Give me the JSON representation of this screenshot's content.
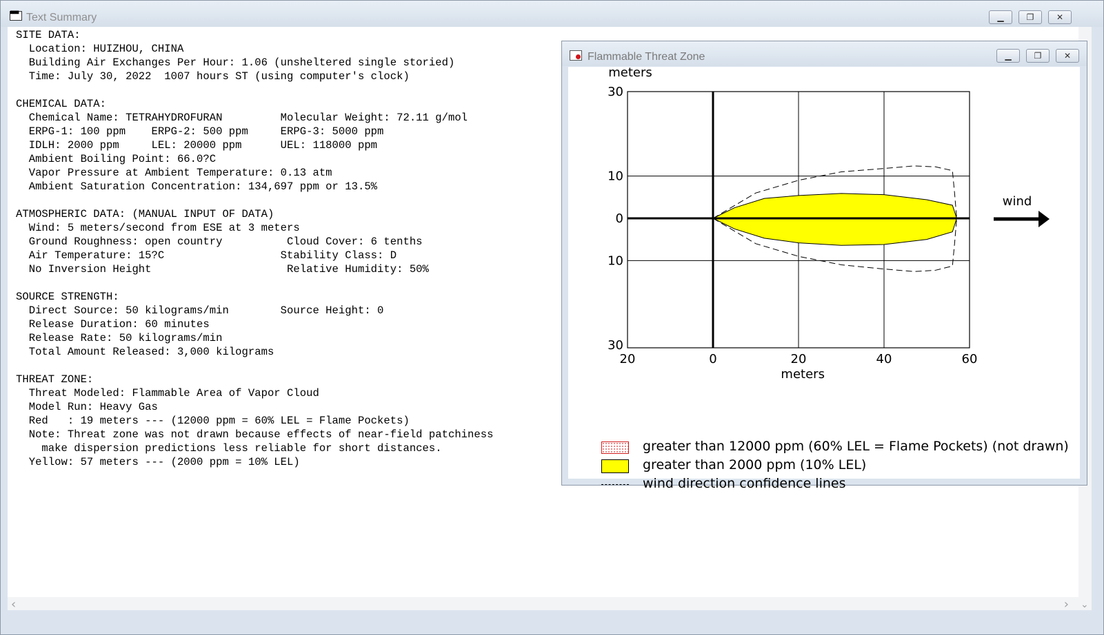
{
  "main_window": {
    "title": "Text Summary",
    "icon": "window-app-icon",
    "controls": {
      "minimize": "minimize-icon",
      "restore": "restore-icon",
      "close": "close-icon"
    }
  },
  "summary_text": "SITE DATA:\n  Location: HUIZHOU, CHINA\n  Building Air Exchanges Per Hour: 1.06 (unsheltered single storied)\n  Time: July 30, 2022  1007 hours ST (using computer's clock)\n\nCHEMICAL DATA:\n  Chemical Name: TETRAHYDROFURAN         Molecular Weight: 72.11 g/mol\n  ERPG-1: 100 ppm    ERPG-2: 500 ppm     ERPG-3: 5000 ppm\n  IDLH: 2000 ppm     LEL: 20000 ppm      UEL: 118000 ppm\n  Ambient Boiling Point: 66.0?C\n  Vapor Pressure at Ambient Temperature: 0.13 atm\n  Ambient Saturation Concentration: 134,697 ppm or 13.5%\n\nATMOSPHERIC DATA: (MANUAL INPUT OF DATA)\n  Wind: 5 meters/second from ESE at 3 meters\n  Ground Roughness: open country          Cloud Cover: 6 tenths\n  Air Temperature: 15?C                  Stability Class: D\n  No Inversion Height                     Relative Humidity: 50%\n\nSOURCE STRENGTH:\n  Direct Source: 50 kilograms/min        Source Height: 0\n  Release Duration: 60 minutes\n  Release Rate: 50 kilograms/min\n  Total Amount Released: 3,000 kilograms\n\nTHREAT ZONE:\n  Threat Modeled: Flammable Area of Vapor Cloud\n  Model Run: Heavy Gas\n  Red   : 19 meters --- (12000 ppm = 60% LEL = Flame Pockets)\n  Note: Threat zone was not drawn because effects of near-field patchiness\n    make dispersion predictions less reliable for short distances.\n  Yellow: 57 meters --- (2000 ppm = 10% LEL)",
  "scrollbar": {
    "right_arrow": "›",
    "left_arrow": "‹",
    "down_arrow": "⌄"
  },
  "threat_window": {
    "title": "Flammable Threat Zone",
    "icon": "threat-zone-icon",
    "wind_label": "wind",
    "legend": [
      {
        "text": "greater than 12000 ppm (60% LEL = Flame Pockets) (not drawn)",
        "swatch": "red-dotted",
        "color": "#d21c1c"
      },
      {
        "text": "greater than 2000 ppm (10% LEL)",
        "swatch": "yellow",
        "color": "#ffff00"
      },
      {
        "text": "wind direction confidence lines",
        "swatch": "dashed-line",
        "color": "#000000"
      }
    ]
  },
  "chart_data": {
    "type": "area",
    "ylabel": "meters",
    "xlabel": "meters",
    "x_ticks": [
      "20",
      "0",
      "20",
      "40",
      "60"
    ],
    "y_ticks": [
      "30",
      "10",
      "0",
      "10",
      "30"
    ],
    "xlim": [
      -20,
      60
    ],
    "ylim": [
      -30,
      30
    ],
    "grid": true,
    "series": [
      {
        "name": "greater than 2000 ppm (10% LEL)",
        "color": "#ffff00",
        "upper": [
          [
            0,
            0
          ],
          [
            5,
            2.5
          ],
          [
            12,
            4.7
          ],
          [
            20,
            5.4
          ],
          [
            30,
            5.9
          ],
          [
            40,
            5.6
          ],
          [
            50,
            4.4
          ],
          [
            56,
            3.1
          ],
          [
            57,
            0
          ]
        ],
        "lower": [
          [
            0,
            0
          ],
          [
            5,
            -2.5
          ],
          [
            12,
            -4.7
          ],
          [
            20,
            -5.8
          ],
          [
            30,
            -6.4
          ],
          [
            40,
            -6.2
          ],
          [
            50,
            -5
          ],
          [
            56,
            -3.2
          ],
          [
            57,
            0
          ]
        ]
      },
      {
        "name": "wind direction confidence lines",
        "style": "dashed",
        "upper": [
          [
            0,
            0
          ],
          [
            10,
            6
          ],
          [
            20,
            9
          ],
          [
            30,
            11
          ],
          [
            40,
            11.8
          ],
          [
            47,
            12.4
          ],
          [
            52,
            12.2
          ],
          [
            56,
            11.3
          ],
          [
            56.5,
            6
          ],
          [
            57,
            0
          ]
        ],
        "lower": [
          [
            0,
            0
          ],
          [
            10,
            -6
          ],
          [
            20,
            -9
          ],
          [
            30,
            -11
          ],
          [
            40,
            -12
          ],
          [
            47,
            -12.6
          ],
          [
            52,
            -12.3
          ],
          [
            56,
            -11.3
          ],
          [
            56.5,
            -6
          ],
          [
            57,
            0
          ]
        ]
      }
    ]
  }
}
